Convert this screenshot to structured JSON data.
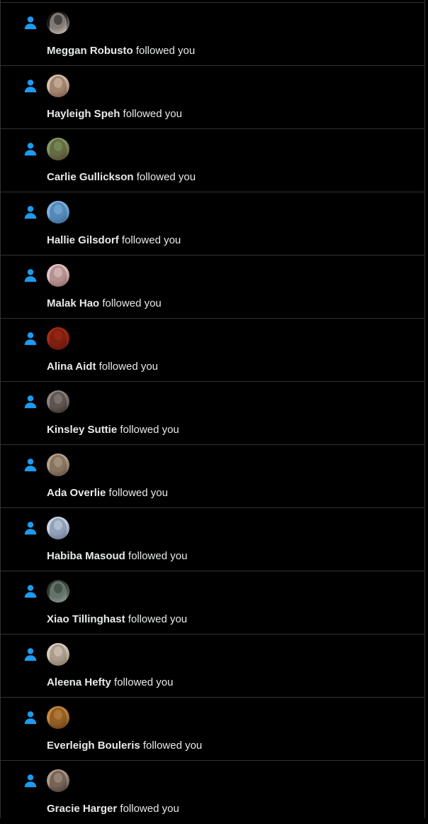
{
  "notifications": [
    {
      "name": "Meggan Robusto",
      "action": "followed you",
      "avatar_colors": [
        "#1a1a1a",
        "#e6dccf"
      ]
    },
    {
      "name": "Hayleigh Speh",
      "action": "followed you",
      "avatar_colors": [
        "#d9c2ad",
        "#6b4a36"
      ]
    },
    {
      "name": "Carlie Gullickson",
      "action": "followed you",
      "avatar_colors": [
        "#7f9a63",
        "#4d3b2a"
      ]
    },
    {
      "name": "Hallie Gilsdorf",
      "action": "followed you",
      "avatar_colors": [
        "#7fb3e0",
        "#2d5f8c"
      ]
    },
    {
      "name": "Malak Hao",
      "action": "followed you",
      "avatar_colors": [
        "#e2c7c7",
        "#8a5a5a"
      ]
    },
    {
      "name": "Alina Aidt",
      "action": "followed you",
      "avatar_colors": [
        "#a32a17",
        "#5a130a"
      ]
    },
    {
      "name": "Kinsley Suttie",
      "action": "followed you",
      "avatar_colors": [
        "#8f8680",
        "#2b2320"
      ]
    },
    {
      "name": "Ada Overlie",
      "action": "followed you",
      "avatar_colors": [
        "#b7a38c",
        "#5a4636"
      ]
    },
    {
      "name": "Habiba Masoud",
      "action": "followed you",
      "avatar_colors": [
        "#c9d6ea",
        "#5b6c86"
      ]
    },
    {
      "name": "Xiao Tillinghast",
      "action": "followed you",
      "avatar_colors": [
        "#2e3a33",
        "#9aa99e"
      ]
    },
    {
      "name": "Aleena Hefty",
      "action": "followed you",
      "avatar_colors": [
        "#d8cfc0",
        "#7d6a55"
      ]
    },
    {
      "name": "Everleigh Bouleris",
      "action": "followed you",
      "avatar_colors": [
        "#c98a3a",
        "#5a3414"
      ]
    },
    {
      "name": "Gracie Harger",
      "action": "followed you",
      "avatar_colors": [
        "#b09a8c",
        "#3c2c24"
      ]
    }
  ],
  "colors": {
    "background": "#000000",
    "divider": "#2f3336",
    "accent_icon": "#1d9bf0",
    "text": "#e7e9ea"
  },
  "icon": "person-follow-icon"
}
